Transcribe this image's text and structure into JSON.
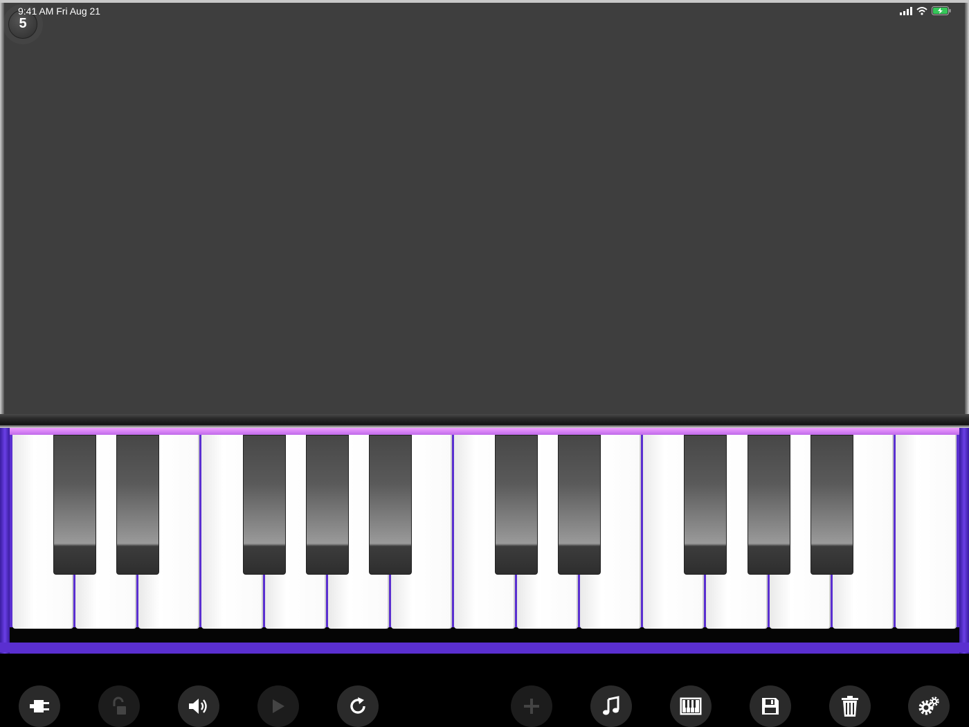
{
  "status_bar": {
    "time_date": "9:41 AM   Fri Aug 21"
  },
  "badge": {
    "value": "5"
  },
  "colors": {
    "accent_purple": "#5a2fd0",
    "pink_strip": "#e08cf6",
    "display_bg": "#3e3e3e"
  },
  "keyboard": {
    "white_key_count": 15,
    "black_key_count": 10
  },
  "toolbar": {
    "buttons": [
      {
        "name": "plugin-button",
        "icon": "plugin-icon",
        "enabled": true
      },
      {
        "name": "lock-button",
        "icon": "unlock-icon",
        "enabled": false
      },
      {
        "name": "volume-button",
        "icon": "speaker-icon",
        "enabled": true
      },
      {
        "name": "play-button",
        "icon": "play-icon",
        "enabled": false
      },
      {
        "name": "reload-button",
        "icon": "reload-icon",
        "enabled": true
      },
      {
        "name": "add-button",
        "icon": "plus-icon",
        "enabled": false
      },
      {
        "name": "music-button",
        "icon": "music-note-icon",
        "enabled": true
      },
      {
        "name": "keyboard-button",
        "icon": "piano-icon",
        "enabled": true
      },
      {
        "name": "save-button",
        "icon": "floppy-icon",
        "enabled": true
      },
      {
        "name": "delete-button",
        "icon": "trash-icon",
        "enabled": true
      },
      {
        "name": "settings-button",
        "icon": "gears-icon",
        "enabled": true
      }
    ]
  }
}
